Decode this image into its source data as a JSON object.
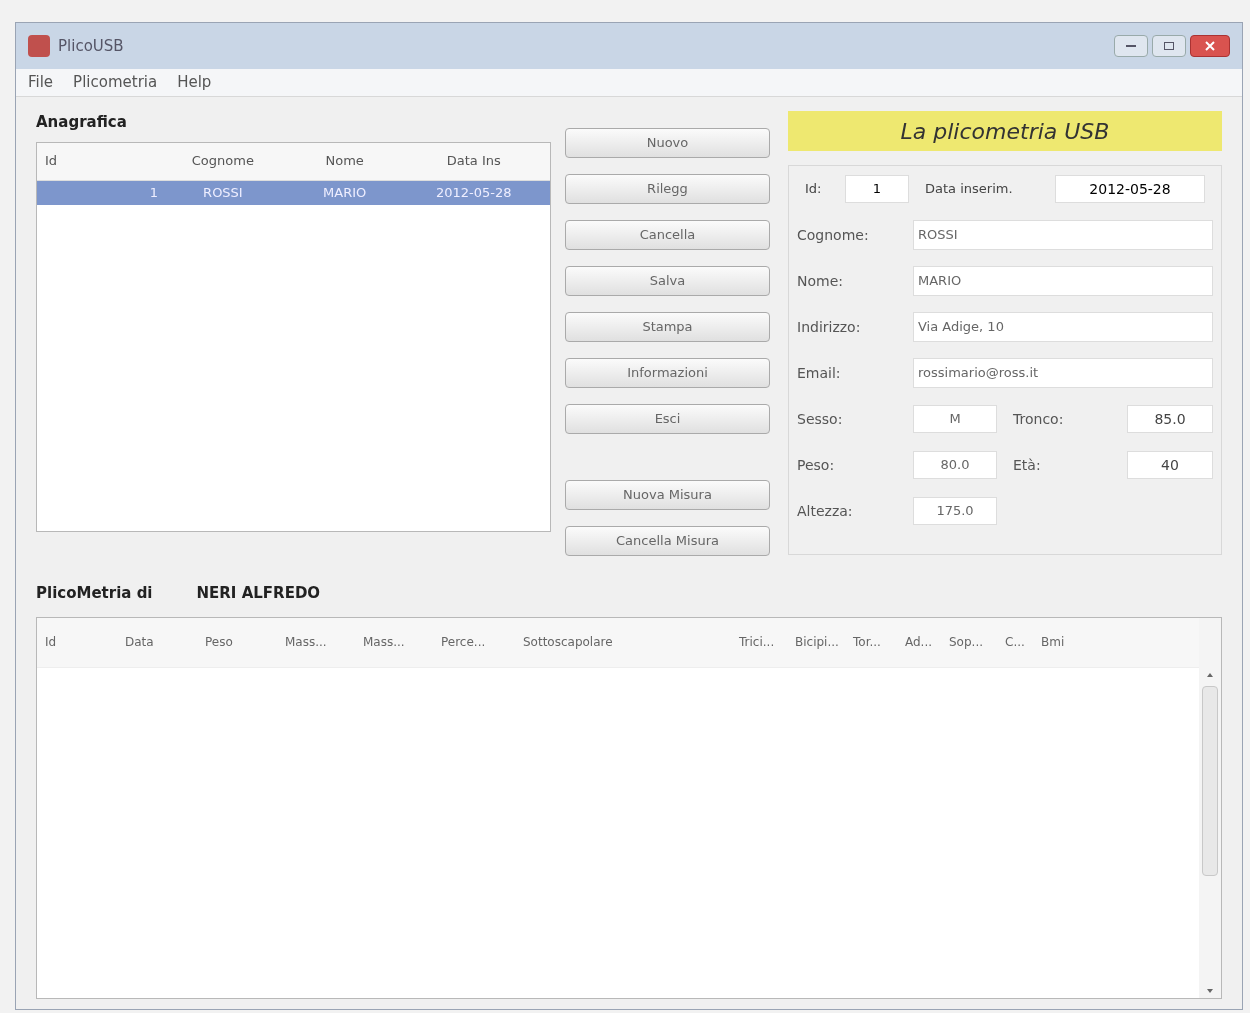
{
  "window": {
    "title": "PlicoUSB"
  },
  "menu": [
    "File",
    "Plicometria",
    "Help"
  ],
  "anagrafica": {
    "title": "Anagrafica",
    "columns": [
      "Id",
      "Cognome",
      "Nome",
      "Data Ins"
    ],
    "rows": [
      {
        "cells": [
          "1",
          "ROSSI",
          "MARIO",
          "2012-05-28"
        ],
        "selected": true
      }
    ]
  },
  "buttons": [
    "Nuovo",
    "Rilegg",
    "Cancella",
    "Salva",
    "Stampa",
    "Informazioni",
    "Esci"
  ],
  "measure_buttons": [
    "Nuova Misura",
    "Cancella Misura"
  ],
  "banner": "La plicometria USB",
  "form": {
    "id_label": "Id:",
    "id": "1",
    "date_label": "Data inserim.",
    "date": "2012-05-28",
    "fields": [
      {
        "label": "Cognome:",
        "value": "ROSSI"
      },
      {
        "label": "Nome:",
        "value": "MARIO"
      },
      {
        "label": "Indirizzo:",
        "value": "Via Adige, 10"
      },
      {
        "label": "Email:",
        "value": "rossimario@ross.it"
      }
    ],
    "pairs": [
      {
        "label": "Sesso:",
        "value": "M",
        "label2": "Tronco:",
        "value2": "85.0"
      },
      {
        "label": "Peso:",
        "value": "80.0",
        "label2": "Età:",
        "value2": "40"
      },
      {
        "label": "Altezza:",
        "value": "175.0"
      }
    ]
  },
  "measures": {
    "title": "PlicoMetria di",
    "person": "NERI ALFREDO",
    "columns": [
      "Id",
      "Data",
      "Peso",
      "Mass...",
      "Mass...",
      "Perce...",
      "Sottoscapolare",
      "Trici...",
      "Bicipi...",
      "Tor...",
      "Ad...",
      "Sop...",
      "C...",
      "Bmi"
    ]
  }
}
